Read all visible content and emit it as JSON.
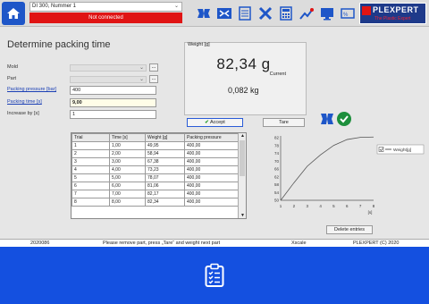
{
  "header": {
    "machine": "DI 300, Nummer 1",
    "connection_status": "Not connected",
    "logo_text": "PLEXPERT",
    "logo_sub": "The Plastic Expert",
    "colors": {
      "accent": "#1e56c8",
      "alert": "#e01414",
      "footer": "#1450e0"
    }
  },
  "toolbar_icons": [
    "home-icon",
    "parameters-icon",
    "compare-icon",
    "list-icon",
    "tools-icon",
    "calculator-icon",
    "chart-icon",
    "monitor-icon",
    "network-icon",
    "display-icon",
    "edit-icon"
  ],
  "page": {
    "title": "Determine packing time"
  },
  "form": {
    "mold_label": "Mold",
    "part_label": "Part",
    "packing_pressure_label": "Packing pressure [bar]",
    "packing_pressure_value": "400",
    "packing_time_label": "Packing time [s]",
    "packing_time_value": "9,00",
    "increase_label": "Increase by [s]",
    "increase_value": "1",
    "dots_label": "..."
  },
  "weight": {
    "label": "Weight [g]",
    "value": "82,34 g",
    "current_label": "Current",
    "sub_value": "0,082 kg"
  },
  "buttons": {
    "accept": "Accept",
    "tare": "Tare",
    "delete": "Delete entries"
  },
  "table": {
    "headers": [
      "Trial",
      "Time [s]",
      "Weight [g]",
      "Packing pressure"
    ],
    "rows": [
      [
        "1",
        "1,00",
        "49,95",
        "400,00"
      ],
      [
        "2",
        "2,00",
        "58,94",
        "400,00"
      ],
      [
        "3",
        "3,00",
        "67,38",
        "400,00"
      ],
      [
        "4",
        "4,00",
        "73,23",
        "400,00"
      ],
      [
        "5",
        "5,00",
        "78,07",
        "400,00"
      ],
      [
        "6",
        "6,00",
        "81,06",
        "400,00"
      ],
      [
        "7",
        "7,00",
        "82,17",
        "400,00"
      ],
      [
        "8",
        "8,00",
        "82,34",
        "400,00"
      ]
    ]
  },
  "chart_data": {
    "type": "line",
    "x": [
      1,
      2,
      3,
      4,
      5,
      6,
      7,
      8
    ],
    "series": [
      {
        "name": "Weight[g]",
        "values": [
          49.95,
          58.94,
          67.38,
          73.23,
          78.07,
          81.06,
          82.17,
          82.34
        ]
      }
    ],
    "xlabel": "[s]",
    "ylabel": "",
    "xlim": [
      1,
      8
    ],
    "ylim": [
      50,
      82
    ],
    "xticks": [
      "1",
      "2",
      "3",
      "4",
      "5",
      "6",
      "7",
      "8"
    ],
    "yticks": [
      "82",
      "78",
      "74",
      "70",
      "66",
      "62",
      "58",
      "54",
      "50"
    ],
    "legend": "right",
    "grid": false
  },
  "status": {
    "left": "2020086",
    "message": "Please remove part, press „Tare“ and weight next part",
    "device": "Xscale",
    "copyright": "PLEXPERT (C) 2020"
  },
  "footer": {
    "icon": "clipboard-checklist-icon"
  }
}
